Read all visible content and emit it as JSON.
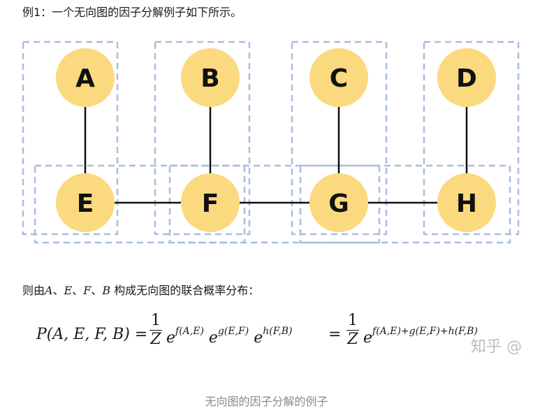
{
  "intro_text": "例1：一个无向图的因子分解例子如下所示。",
  "nodes": [
    {
      "id": "A",
      "label": "A"
    },
    {
      "id": "B",
      "label": "B"
    },
    {
      "id": "C",
      "label": "C"
    },
    {
      "id": "D",
      "label": "D"
    },
    {
      "id": "E",
      "label": "E"
    },
    {
      "id": "F",
      "label": "F"
    },
    {
      "id": "G",
      "label": "G"
    },
    {
      "id": "H",
      "label": "H"
    }
  ],
  "edges": [
    [
      "A",
      "E"
    ],
    [
      "B",
      "F"
    ],
    [
      "C",
      "G"
    ],
    [
      "D",
      "H"
    ],
    [
      "E",
      "F"
    ],
    [
      "F",
      "G"
    ],
    [
      "G",
      "H"
    ]
  ],
  "colors": {
    "node_fill": "#fbd97e",
    "box_stroke": "#a9bde0",
    "edge": "#111111"
  },
  "description": {
    "prefix": "则由",
    "vars": [
      "A",
      "E",
      "F",
      "B"
    ],
    "sep": "、",
    "suffix": " 构成无向图的联合概率分布："
  },
  "formula": {
    "lhs": "P(A, E, F, B) =",
    "frac_num": "1",
    "frac_den": "Z",
    "base": "e",
    "exp1": "f(A,E)",
    "exp2": "g(E,F)",
    "exp3": "h(F,B)",
    "eq2": "=",
    "exp_sum": "f(A,E)+g(E,F)+h(F,B)"
  },
  "watermark": "知乎 @",
  "caption": "无向图的因子分解的例子"
}
